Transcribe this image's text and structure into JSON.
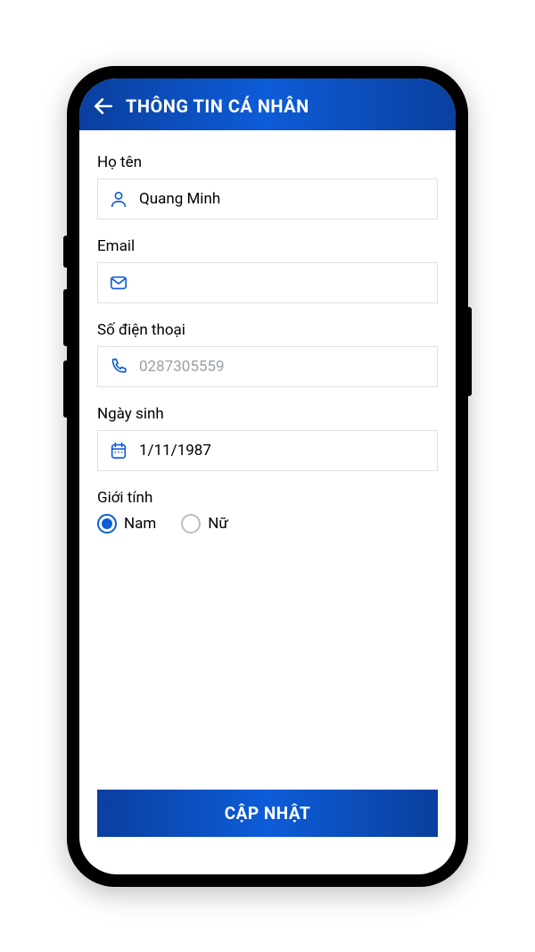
{
  "header": {
    "title": "THÔNG TIN CÁ NHÂN"
  },
  "form": {
    "name": {
      "label": "Họ tên",
      "value": "Quang Minh"
    },
    "email": {
      "label": "Email",
      "value": ""
    },
    "phone": {
      "label": "Số điện thoại",
      "value": "0287305559"
    },
    "dob": {
      "label": "Ngày sinh",
      "value": "1/11/1987"
    },
    "gender": {
      "label": "Giới tính",
      "options": {
        "male": "Nam",
        "female": "Nữ"
      },
      "selected": "male"
    }
  },
  "actions": {
    "submit": "CẬP NHẬT"
  }
}
